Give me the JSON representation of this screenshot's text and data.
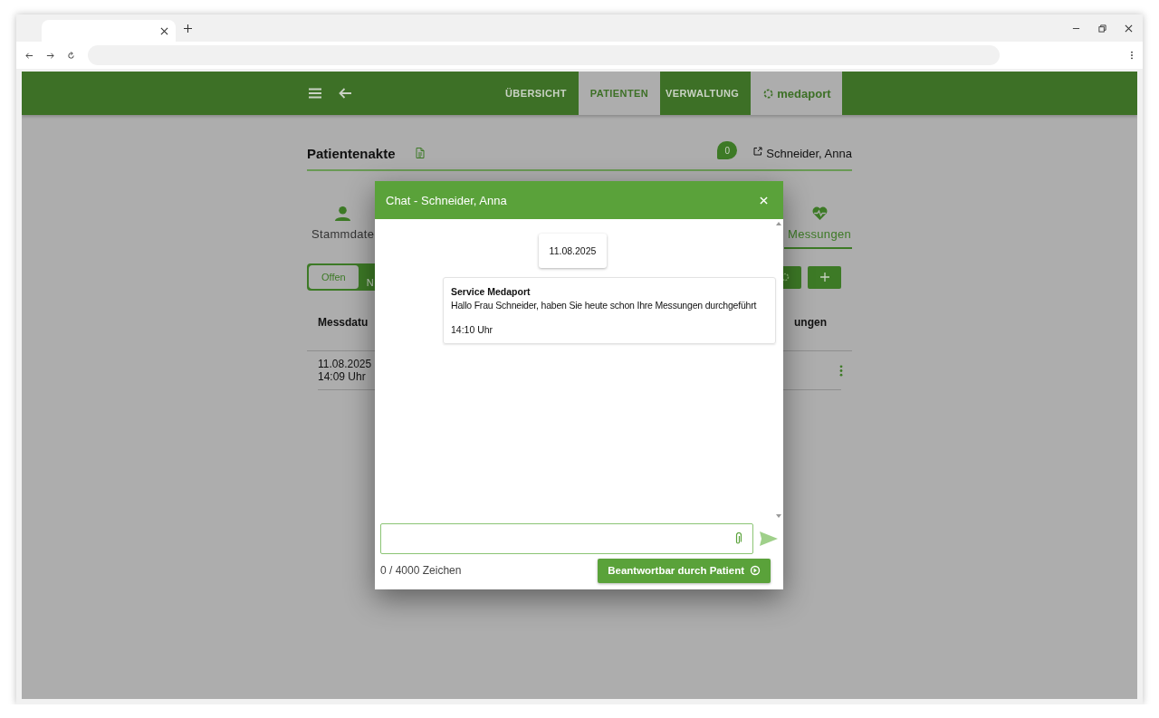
{
  "nav": {
    "items": [
      {
        "label": "ÜBERSICHT",
        "selected": false
      },
      {
        "label": "PATIENTEN",
        "selected": true
      },
      {
        "label": "VERWALTUNG",
        "selected": false
      }
    ],
    "brand": "medaport"
  },
  "record": {
    "title": "Patientenakte",
    "chat_count": "0",
    "patient": "Schneider, Anna"
  },
  "sections": [
    {
      "label": "Stammdate",
      "selected": false
    },
    {
      "label": "Messungen",
      "selected": true
    }
  ],
  "filter": [
    {
      "label": "Offen",
      "selected": true
    },
    {
      "label": "N",
      "selected": false
    }
  ],
  "table": {
    "columns": [
      "Messdatu",
      "ungen"
    ],
    "rows": [
      {
        "date": "11.08.2025",
        "time": "14:09 Uhr"
      }
    ]
  },
  "chat": {
    "title": "Chat - Schneider, Anna",
    "date": "11.08.2025",
    "messages": [
      {
        "sender": "Service Medaport",
        "text": "Hallo Frau Schneider, haben Sie heute schon Ihre Messungen durchgeführt",
        "time": "14:10 Uhr"
      }
    ],
    "counter": "0 / 4000 Zeichen",
    "reply_button": "Beantwortbar durch Patient"
  }
}
